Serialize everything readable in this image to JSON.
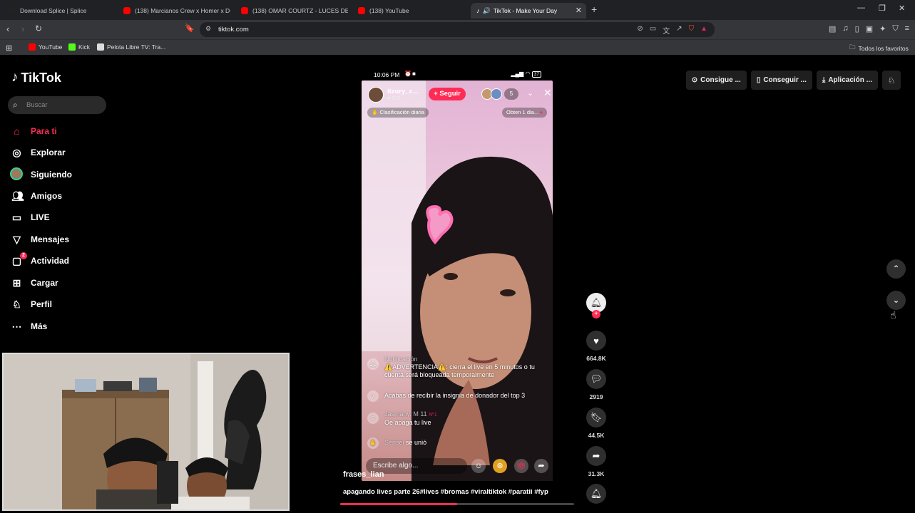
{
  "browser": {
    "tabs": [
      {
        "label": "Download Splice | Splice",
        "icon": "splice-icon",
        "active": false
      },
      {
        "label": "(138) Marcianos Crew x Homer x Dul",
        "icon": "youtube-icon",
        "active": false
      },
      {
        "label": "(138) OMAR COURTZ - LUCES DE CO",
        "icon": "youtube-icon",
        "active": false
      },
      {
        "label": "(138) YouTube",
        "icon": "youtube-icon",
        "active": false
      },
      {
        "label": "TikTok - Make Your Day",
        "icon": "tiktok-icon",
        "active": true
      }
    ],
    "url": "tiktok.com",
    "bookmarks": [
      {
        "label": "YouTube",
        "color": "#ff0000"
      },
      {
        "label": "Kick",
        "color": "#53fc18"
      },
      {
        "label": "Pelota Libre TV: Tra..."
      }
    ],
    "all_bookmarks_label": "Todos los favoritos"
  },
  "tiktok": {
    "logo_text": "TikTok",
    "search_placeholder": "Buscar",
    "menu": [
      {
        "label": "Para ti",
        "icon": "home-icon",
        "active": true
      },
      {
        "label": "Explorar",
        "icon": "compass-icon"
      },
      {
        "label": "Siguiendo",
        "icon": "avatar-icon"
      },
      {
        "label": "Amigos",
        "icon": "friends-icon"
      },
      {
        "label": "LIVE",
        "icon": "live-icon"
      },
      {
        "label": "Mensajes",
        "icon": "send-icon"
      },
      {
        "label": "Actividad",
        "icon": "inbox-icon",
        "badge": "2"
      },
      {
        "label": "Cargar",
        "icon": "plus-square-icon"
      },
      {
        "label": "Perfil",
        "icon": "profile-icon"
      },
      {
        "label": "Más",
        "icon": "more-icon"
      }
    ],
    "top_actions": [
      {
        "label": "Consigue ...",
        "icon": "coin-icon"
      },
      {
        "label": "Conseguir ...",
        "icon": "phone-icon"
      },
      {
        "label": "Aplicación ...",
        "icon": "download-icon"
      }
    ],
    "accent": "#fe2c55"
  },
  "live": {
    "status_time": "10:06 PM",
    "battery": "37",
    "host_name": "itzury_c...",
    "host_likes": "623",
    "follow_label": "Seguir",
    "viewer_count": "5",
    "rank_label": "Clasificación diaria",
    "gift_label": "Obten 1 dia...",
    "notification_title": "Notificación",
    "messages": [
      {
        "text": "⚠️ADVERTENCIA⚠️: cierra el live en 5 minutos o tu cuenta será bloqueada temporalmente"
      },
      {
        "text": "Acabas de recibir la insignia de donador del top 3"
      },
      {
        "user": "Jasmany. M 11",
        "rank": "Nº1",
        "text": "Oe apaga tu live"
      },
      {
        "user": "Sensei",
        "text": "se unió"
      }
    ],
    "input_placeholder": "Escribe algo...",
    "caption_user": "frases_lian",
    "caption_text": "apagando lives parte 26#lives #bromas #viraltiktok #paratii #fyp",
    "progress": 0.5
  },
  "actions": {
    "likes": "664.8K",
    "comments": "2919",
    "saves": "44.5K",
    "shares": "31.3K"
  }
}
